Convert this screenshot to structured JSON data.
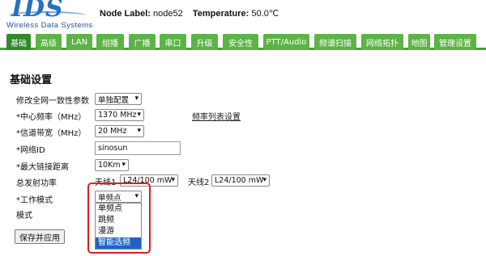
{
  "brand": {
    "logo_text": "IDS",
    "logo_sub": "Wireless Data Systems",
    "brand_color": "#2a6fc0"
  },
  "node": {
    "label_caption": "Node Label:",
    "label_value": "node52",
    "temp_caption": "Temperature:",
    "temp_value": "50.0℃"
  },
  "tabs": [
    {
      "label": "基础",
      "active": true
    },
    {
      "label": "高级"
    },
    {
      "label": "LAN"
    },
    {
      "label": "组播"
    },
    {
      "label": "广播"
    },
    {
      "label": "串口"
    },
    {
      "label": "升级"
    },
    {
      "label": "安全性"
    },
    {
      "label": "PTT/Audio"
    },
    {
      "label": "频谱扫描"
    },
    {
      "label": "网络拓扑"
    },
    {
      "label": "地图"
    },
    {
      "label": "管理设置"
    }
  ],
  "tab_colors": {
    "normal": "#5cb346",
    "active": "#2f8a27"
  },
  "section_title": "基础设置",
  "form": {
    "consistency": {
      "label": "修改全网一致性参数",
      "value": "单独配置"
    },
    "freq": {
      "label": "*中心频率（MHz）",
      "value": "1370 MHz",
      "link": "频率列表设置"
    },
    "bw": {
      "label": "*信道带宽（MHz）",
      "value": "20 MHz"
    },
    "netid": {
      "label": "*网络ID",
      "value": "sinosun"
    },
    "dist": {
      "label": "*最大链接距离",
      "value": "10Km"
    },
    "power": {
      "label": "总发射功率",
      "ant1_label": "天线1",
      "ant1_value": "L24/100 mW",
      "ant2_label": "天线2",
      "ant2_value": "L24/100 mW"
    },
    "workmode": {
      "label": "*工作模式",
      "value": "单频点"
    },
    "mode": {
      "label": "模式"
    }
  },
  "dropdown_options": [
    "单频点",
    "跳频",
    "漫游",
    "智能选频"
  ],
  "highlighted_option": "智能选频",
  "save_button": "保存并应用"
}
